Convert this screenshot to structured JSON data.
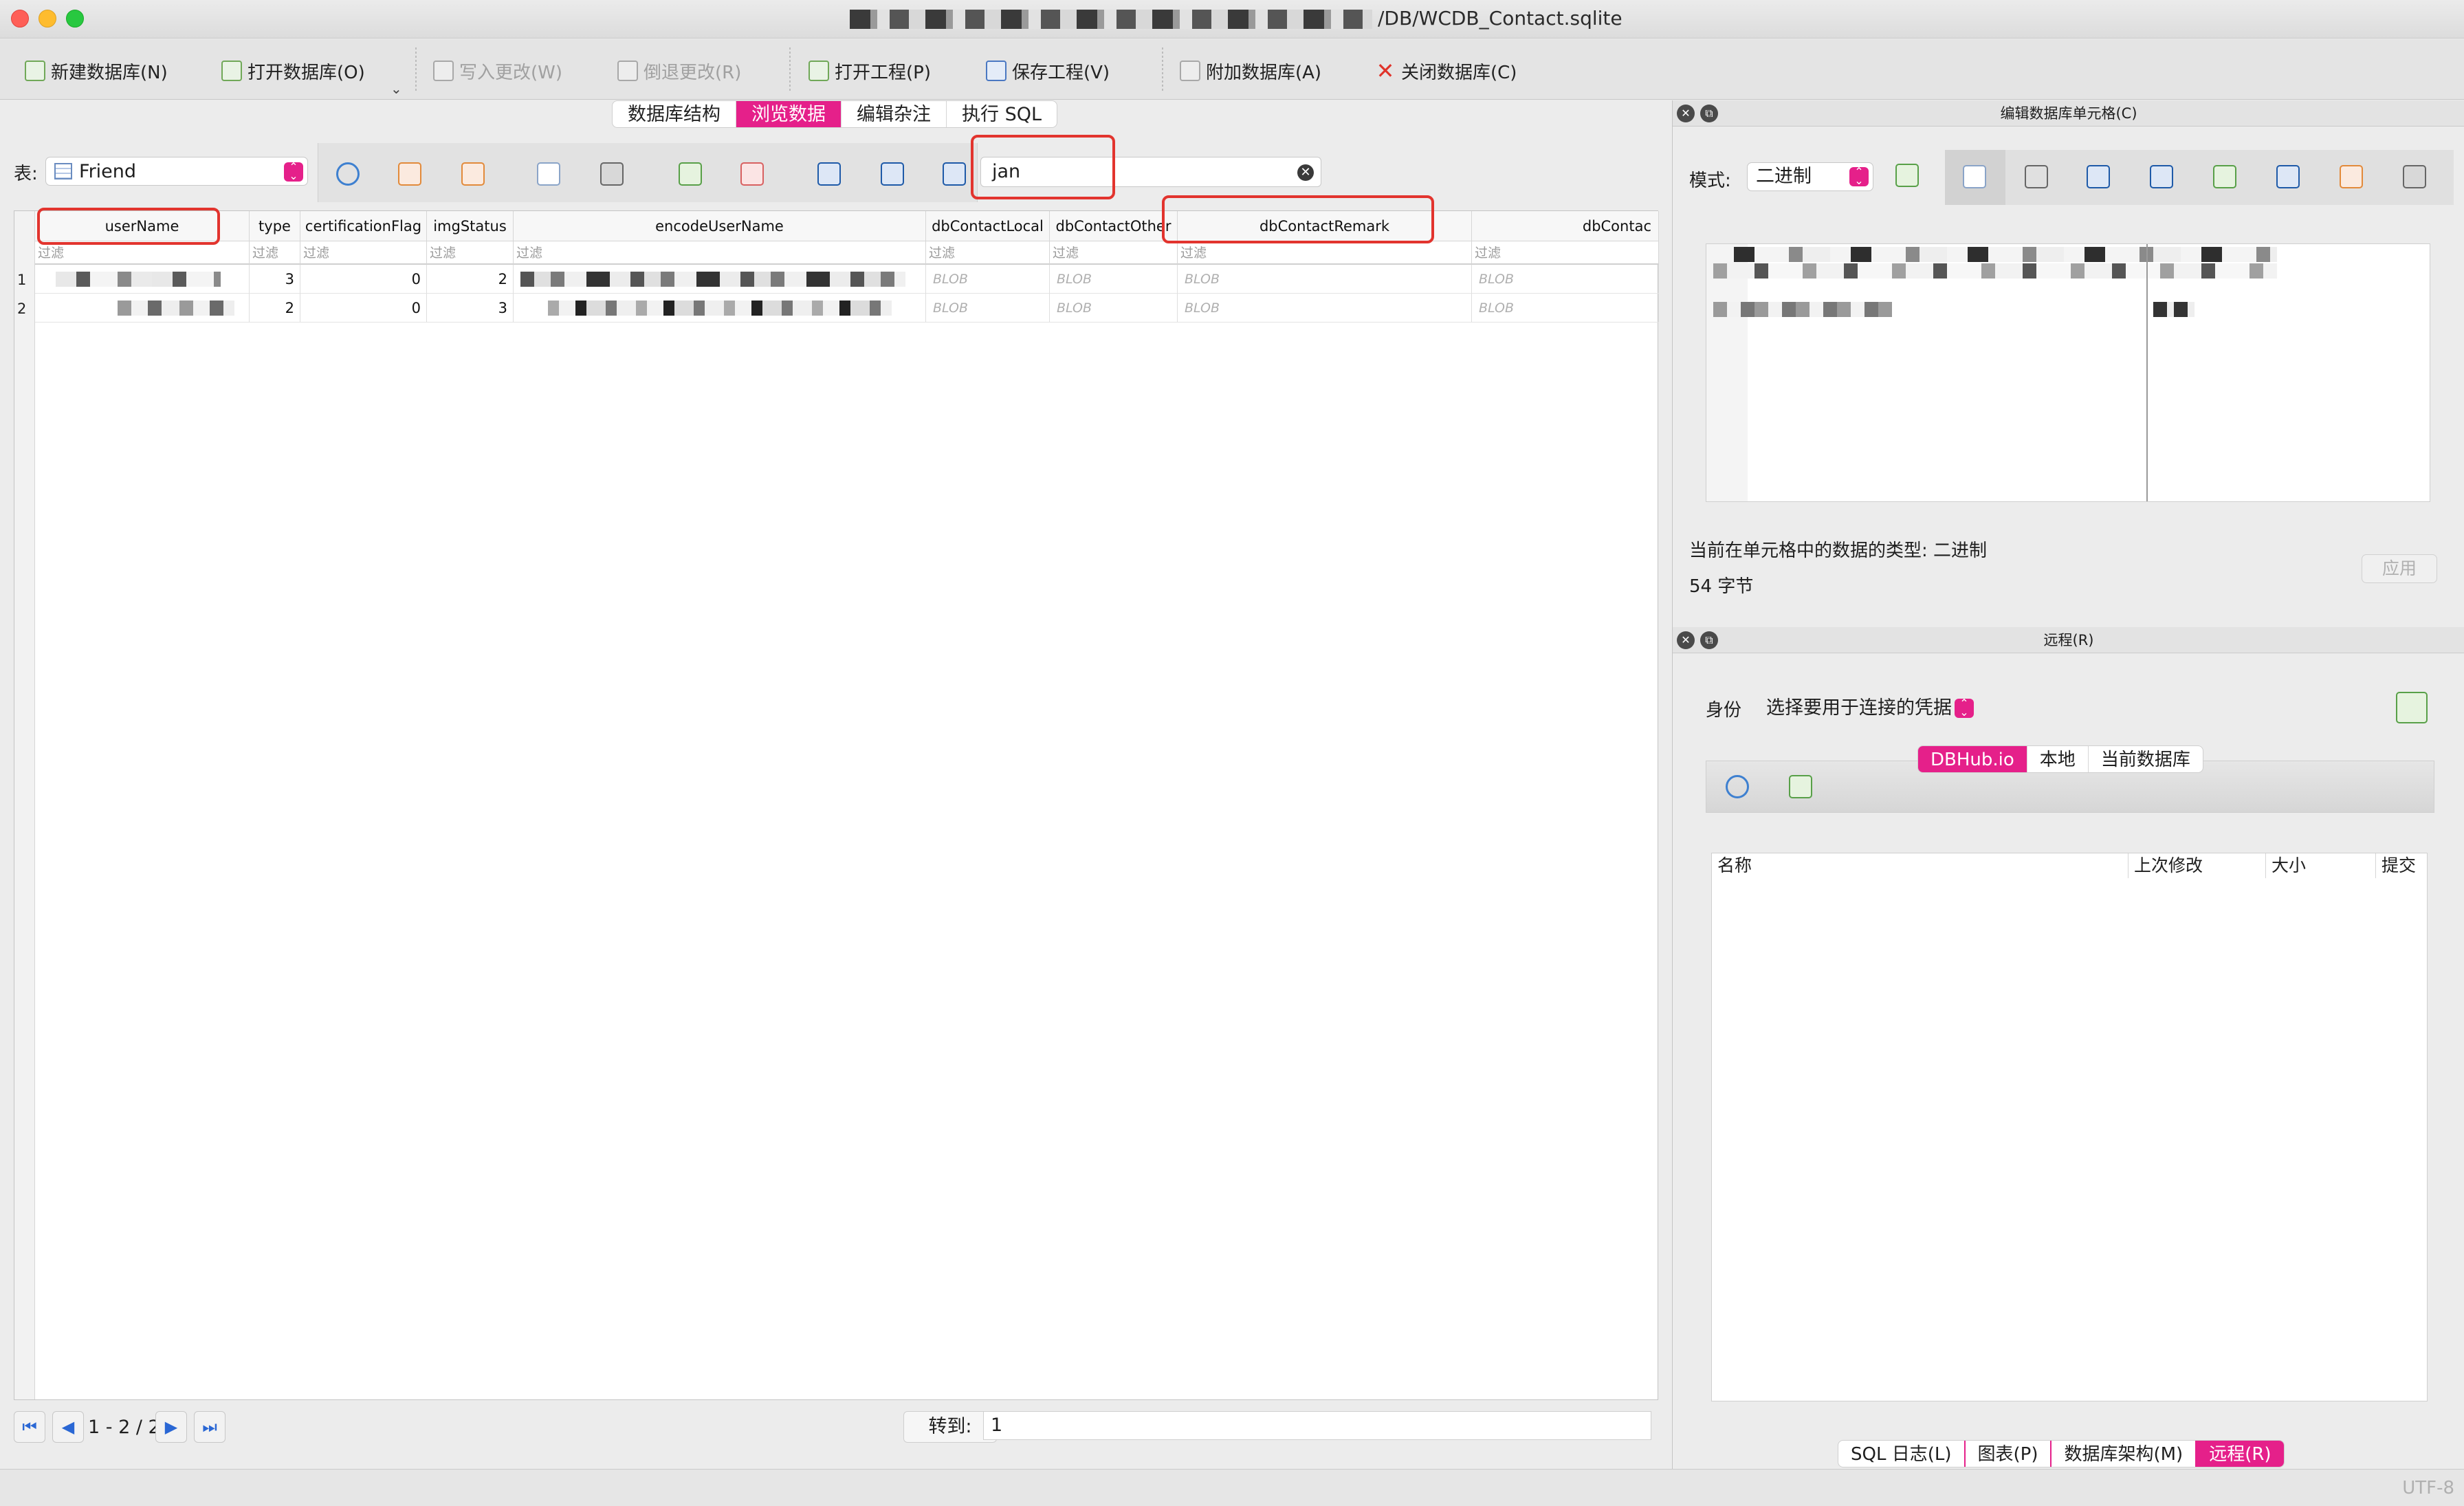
{
  "window": {
    "title": "/DB/WCDB_Contact.sqlite"
  },
  "toolbar": {
    "new_db": "新建数据库(N)",
    "open_db": "打开数据库(O)",
    "write_changes": "写入更改(W)",
    "revert_changes": "倒退更改(R)",
    "open_project": "打开工程(P)",
    "save_project": "保存工程(V)",
    "attach_db": "附加数据库(A)",
    "close_db": "关闭数据库(C)"
  },
  "main_tabs": {
    "structure": "数据库结构",
    "browse": "浏览数据",
    "pragmas": "编辑杂注",
    "sql": "执行 SQL",
    "active": "browse"
  },
  "table_bar": {
    "label": "表:",
    "table_name": "Friend",
    "filter_value": "jan"
  },
  "grid": {
    "columns": [
      "userName",
      "type",
      "certificationFlag",
      "imgStatus",
      "encodeUserName",
      "dbContactLocal",
      "dbContactOther",
      "dbContactRemark",
      "dbContac"
    ],
    "filter_placeholder": "过滤",
    "rows": [
      {
        "num": "1",
        "type": "3",
        "certificationFlag": "0",
        "imgStatus": "2",
        "blob": "BLOB"
      },
      {
        "num": "2",
        "type": "2",
        "certificationFlag": "0",
        "imgStatus": "3",
        "blob": "BLOB"
      }
    ]
  },
  "pager": {
    "info": "1 - 2 / 2",
    "goto_label": "转到:",
    "goto_value": "1"
  },
  "edit_cell_panel": {
    "title": "编辑数据库单元格(C)",
    "mode_label": "模式:",
    "mode_value": "二进制",
    "type_text": "当前在单元格中的数据的类型: 二进制",
    "size_text": "54 字节",
    "apply": "应用"
  },
  "remote_panel": {
    "title": "远程(R)",
    "identity_label": "身份",
    "credential_placeholder": "选择要用于连接的凭据",
    "tabs": [
      "DBHub.io",
      "本地",
      "当前数据库"
    ],
    "active_tab": "DBHub.io",
    "columns": [
      "名称",
      "上次修改",
      "大小",
      "提交"
    ]
  },
  "bottom_tabs": [
    "SQL 日志(L)",
    "图表(P)",
    "数据库架构(M)",
    "远程(R)"
  ],
  "status": {
    "encoding": "UTF-8"
  },
  "colors": {
    "accent": "#e5208a",
    "highlight": "#e2342e"
  }
}
